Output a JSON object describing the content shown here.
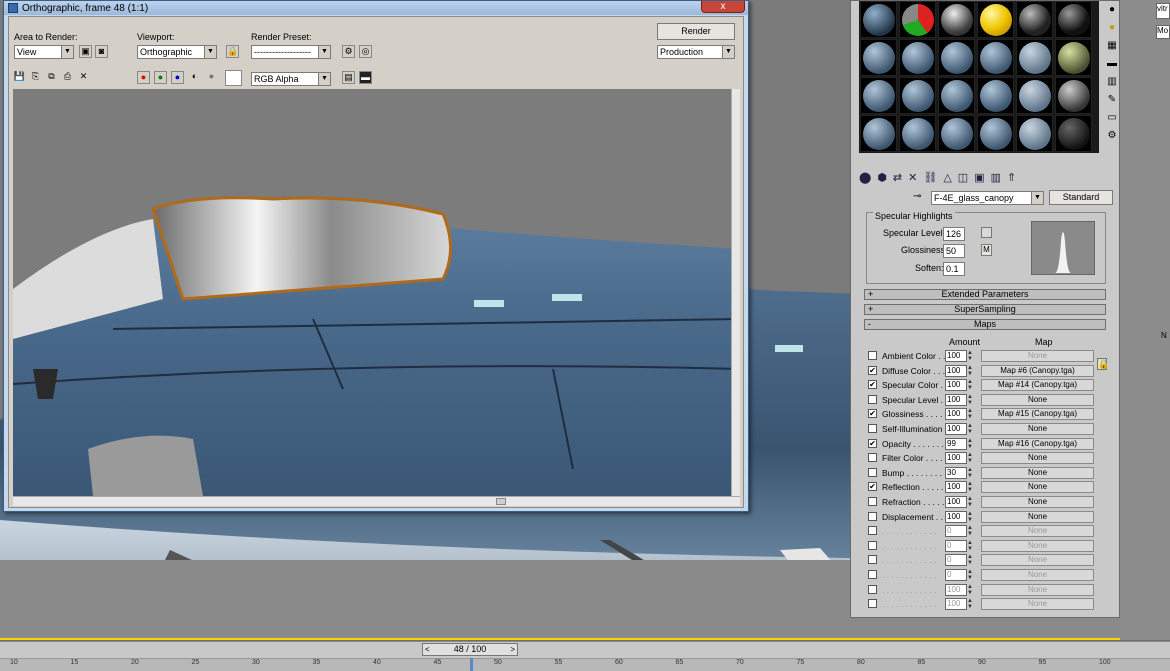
{
  "render_window": {
    "title": "Orthographic, frame 48 (1:1)",
    "close_label": "x",
    "area_to_render_label": "Area to Render:",
    "area_to_render_value": "View",
    "viewport_label": "Viewport:",
    "viewport_value": "Orthographic",
    "render_preset_label": "Render Preset:",
    "render_preset_value": "-------------------",
    "render_button": "Render",
    "production_value": "Production",
    "channel_value": "RGB Alpha"
  },
  "material_editor": {
    "material_name": "F-4E_glass_canopy",
    "material_type": "Standard",
    "specular": {
      "group_label": "Specular Highlights",
      "specular_level_label": "Specular Level:",
      "specular_level_value": "126",
      "glossiness_label": "Glossiness:",
      "glossiness_value": "50",
      "glossiness_map_button": "M",
      "soften_label": "Soften:",
      "soften_value": "0.1"
    },
    "rollouts": [
      {
        "sign": "+",
        "label": "Extended Parameters"
      },
      {
        "sign": "+",
        "label": "SuperSampling"
      },
      {
        "sign": "-",
        "label": "Maps"
      }
    ],
    "maps_header": {
      "amount": "Amount",
      "map": "Map"
    },
    "maps": [
      {
        "checked": false,
        "name": "Ambient Color . . .",
        "amount": "100",
        "map": "None",
        "enabled": true,
        "map_disabled": true
      },
      {
        "checked": true,
        "name": "Diffuse Color . . .",
        "amount": "100",
        "map": "Map #6 (Canopy.tga)",
        "enabled": true
      },
      {
        "checked": true,
        "name": "Specular Color . .",
        "amount": "100",
        "map": "Map #14 (Canopy.tga)",
        "enabled": true
      },
      {
        "checked": false,
        "name": "Specular Level . .",
        "amount": "100",
        "map": "None",
        "enabled": true
      },
      {
        "checked": true,
        "name": "Glossiness . . . . .",
        "amount": "100",
        "map": "Map #15 (Canopy.tga)",
        "enabled": true
      },
      {
        "checked": false,
        "name": "Self-Illumination .",
        "amount": "100",
        "map": "None",
        "enabled": true
      },
      {
        "checked": true,
        "name": "Opacity . . . . . . .",
        "amount": "99",
        "map": "Map #16 (Canopy.tga)",
        "enabled": true
      },
      {
        "checked": false,
        "name": "Filter Color . . . .",
        "amount": "100",
        "map": "None",
        "enabled": true
      },
      {
        "checked": false,
        "name": "Bump . . . . . . . .",
        "amount": "30",
        "map": "None",
        "enabled": true
      },
      {
        "checked": true,
        "name": "Reflection . . . . .",
        "amount": "100",
        "map": "None",
        "enabled": true
      },
      {
        "checked": false,
        "name": "Refraction . . . . .",
        "amount": "100",
        "map": "None",
        "enabled": true
      },
      {
        "checked": false,
        "name": "Displacement . . .",
        "amount": "100",
        "map": "None",
        "enabled": true
      },
      {
        "checked": false,
        "name": ". . . . . . . . . . . .",
        "amount": "0",
        "map": "None",
        "enabled": false
      },
      {
        "checked": false,
        "name": ". . . . . . . . . . . .",
        "amount": "0",
        "map": "None",
        "enabled": false
      },
      {
        "checked": false,
        "name": ". . . . . . . . . . . .",
        "amount": "0",
        "map": "None",
        "enabled": false
      },
      {
        "checked": false,
        "name": ". . . . . . . . . . . .",
        "amount": "0",
        "map": "None",
        "enabled": false
      },
      {
        "checked": false,
        "name": ". . . . . . . . . . . .",
        "amount": "100",
        "map": "None",
        "enabled": false
      },
      {
        "checked": false,
        "name": ". . . . . . . . . . . .",
        "amount": "100",
        "map": "None",
        "enabled": false
      }
    ]
  },
  "command_panel": {
    "field_value": "vitr",
    "mod_label": "Mo",
    "na_label": "N"
  },
  "timeline": {
    "frame_display": "48 / 100",
    "current_frame": 48,
    "total_frames": 100,
    "ticks": [
      "10",
      "15",
      "20",
      "25",
      "30",
      "35",
      "40",
      "45",
      "50",
      "55",
      "60",
      "65",
      "70",
      "75",
      "80",
      "85",
      "90",
      "95",
      "100"
    ]
  },
  "colors": {
    "accent_yellow": "#ffd200",
    "aircraft_blue": "#3d5570",
    "window_frame": "#c6d8ec",
    "canopy_frame": "#b06a1a"
  },
  "icons": [
    "save-icon",
    "copy-icon",
    "clone-icon",
    "print-icon",
    "clear-icon",
    "red-channel-icon",
    "green-channel-icon",
    "blue-channel-icon",
    "alpha-icon",
    "mono-icon",
    "color-swatch-icon",
    "lock-icon",
    "render-setup-icon",
    "environment-icon",
    "pick-material-icon",
    "sample-type-icon",
    "backlight-icon",
    "background-icon",
    "uv-tiling-icon",
    "video-check-icon",
    "make-preview-icon",
    "options-icon",
    "material-nav-icon"
  ]
}
